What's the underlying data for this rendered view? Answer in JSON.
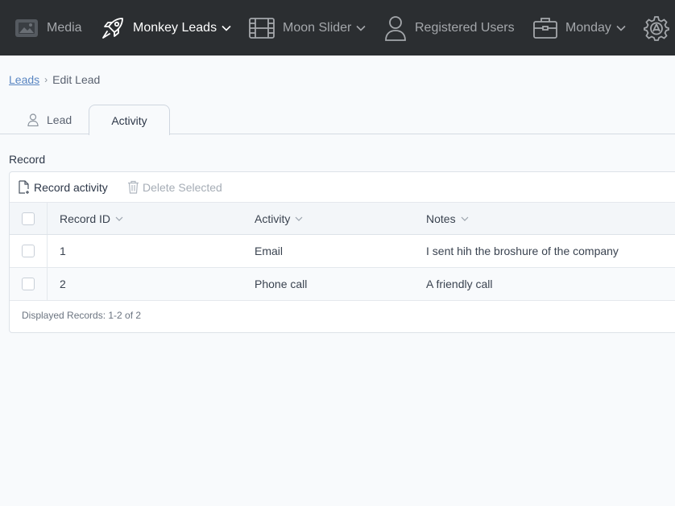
{
  "nav": {
    "media": "Media",
    "leads": "Monkey Leads",
    "moon": "Moon Slider",
    "users": "Registered Users",
    "monday": "Monday"
  },
  "breadcrumb": {
    "root": "Leads",
    "separator": "›",
    "current": "Edit Lead"
  },
  "tabs": {
    "lead": "Lead",
    "activity": "Activity"
  },
  "section": {
    "label": "Record"
  },
  "toolbar": {
    "record_activity": "Record activity",
    "delete_selected": "Delete Selected"
  },
  "table": {
    "columns": [
      "Record ID",
      "Activity",
      "Notes"
    ],
    "rows": [
      {
        "id": "1",
        "activity": "Email",
        "notes": "I sent hih the broshure of the company"
      },
      {
        "id": "2",
        "activity": "Phone call",
        "notes": "A friendly call"
      }
    ],
    "footer": "Displayed Records: 1-2 of 2"
  },
  "colors": {
    "topbar": "#2b2e31",
    "link": "#5a86c2"
  }
}
